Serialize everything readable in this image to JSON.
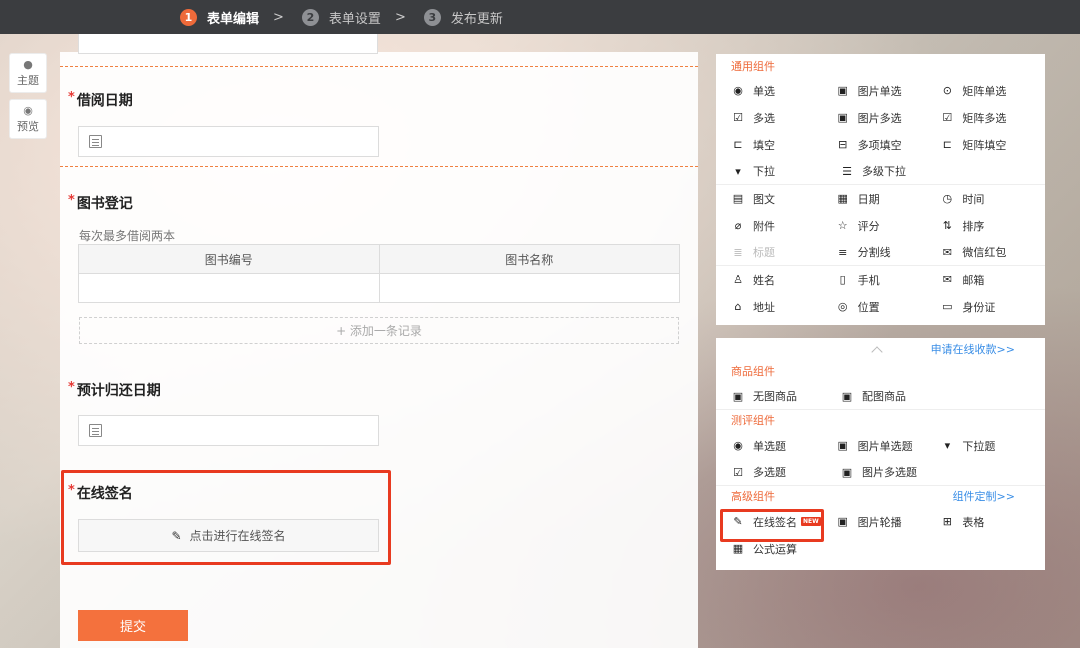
{
  "steps": [
    {
      "num": "1",
      "label": "表单编辑"
    },
    {
      "num": "2",
      "label": "表单设置"
    },
    {
      "num": "3",
      "label": "发布更新"
    }
  ],
  "side": {
    "theme": "主题",
    "preview": "预览"
  },
  "form": {
    "q1": "借阅日期",
    "q2": "图书登记",
    "q2_hint": "每次最多借阅两本",
    "q2_cols": [
      "图书编号",
      "图书名称"
    ],
    "add_record": "+ 添加一条记录",
    "q3": "预计归还日期",
    "q4": "在线签名",
    "sign_btn": "点击进行在线签名",
    "submit": "提交"
  },
  "panel": {
    "general": "通用组件",
    "general_rows": [
      [
        {
          "icon": "◉",
          "label": "单选"
        },
        {
          "icon": "▣",
          "label": "图片单选"
        },
        {
          "icon": "⊙",
          "label": "矩阵单选"
        }
      ],
      [
        {
          "icon": "☑",
          "label": "多选"
        },
        {
          "icon": "▣",
          "label": "图片多选"
        },
        {
          "icon": "☑",
          "label": "矩阵多选"
        }
      ],
      [
        {
          "icon": "⊏",
          "label": "填空"
        },
        {
          "icon": "⊟",
          "label": "多项填空"
        },
        {
          "icon": "⊏",
          "label": "矩阵填空"
        }
      ],
      [
        {
          "icon": "▾",
          "label": "下拉"
        },
        {
          "icon": "☰",
          "label": "多级下拉"
        }
      ],
      [
        {
          "icon": "▤",
          "label": "图文"
        },
        {
          "icon": "▦",
          "label": "日期"
        },
        {
          "icon": "◷",
          "label": "时间"
        }
      ],
      [
        {
          "icon": "⌀",
          "label": "附件"
        },
        {
          "icon": "☆",
          "label": "评分"
        },
        {
          "icon": "⇅",
          "label": "排序"
        }
      ],
      [
        {
          "icon": "≣",
          "label": "标题"
        },
        {
          "icon": "≡",
          "label": "分割线"
        },
        {
          "icon": "✉",
          "label": "微信红包"
        }
      ],
      [
        {
          "icon": "♙",
          "label": "姓名"
        },
        {
          "icon": "▯",
          "label": "手机"
        },
        {
          "icon": "✉",
          "label": "邮箱"
        }
      ],
      [
        {
          "icon": "⌂",
          "label": "地址"
        },
        {
          "icon": "◎",
          "label": "位置"
        },
        {
          "icon": "▭",
          "label": "身份证"
        }
      ]
    ],
    "apply_link": "申请在线收款>>",
    "goods": "商品组件",
    "goods_row": [
      {
        "icon": "▣",
        "label": "无图商品"
      },
      {
        "icon": "▣",
        "label": "配图商品"
      }
    ],
    "eval": "测评组件",
    "eval_rows": [
      [
        {
          "icon": "◉",
          "label": "单选题"
        },
        {
          "icon": "▣",
          "label": "图片单选题"
        },
        {
          "icon": "▾",
          "label": "下拉题"
        }
      ],
      [
        {
          "icon": "☑",
          "label": "多选题"
        },
        {
          "icon": "▣",
          "label": "图片多选题"
        }
      ]
    ],
    "advanced": "高级组件",
    "custom_link": "组件定制>>",
    "adv_rows": [
      [
        {
          "icon": "✎",
          "label": "在线签名",
          "badge": "NEW"
        },
        {
          "icon": "▣",
          "label": "图片轮播"
        },
        {
          "icon": "⊞",
          "label": "表格"
        }
      ],
      [
        {
          "icon": "▦",
          "label": "公式运算"
        }
      ]
    ],
    "accent": "#ee6a3a",
    "link_color": "#3a8ee6"
  }
}
